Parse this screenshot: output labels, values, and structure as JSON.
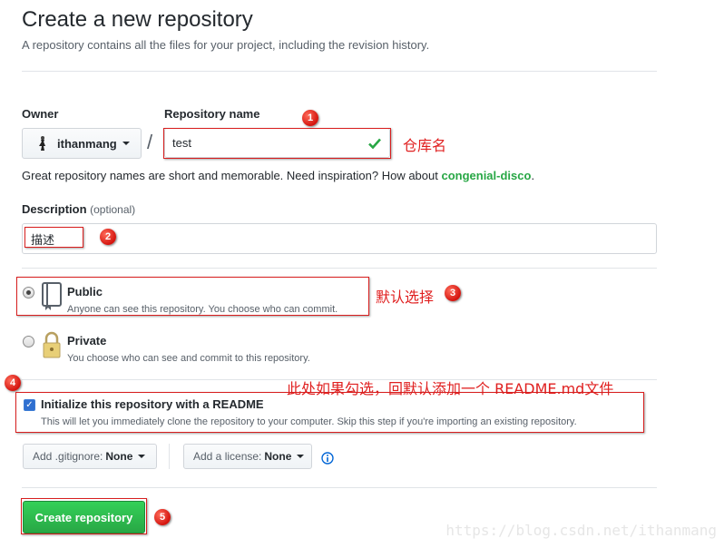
{
  "header": {
    "title": "Create a new repository",
    "subtitle": "A repository contains all the files for your project, including the revision history."
  },
  "owner": {
    "label": "Owner",
    "value": "ithanmang",
    "avatar_icon": "user-avatar"
  },
  "repo_name": {
    "label": "Repository name",
    "value": "test",
    "separator": "/",
    "valid_icon": "check-icon"
  },
  "name_hint": {
    "text": "Great repository names are short and memorable. Need inspiration? How about ",
    "suggestion": "congenial-disco",
    "suffix": "."
  },
  "description": {
    "label": "Description",
    "optional": "(optional)",
    "value": "描述"
  },
  "visibility": {
    "public": {
      "title": "Public",
      "note": "Anyone can see this repository. You choose who can commit.",
      "selected": true,
      "icon": "book-icon"
    },
    "private": {
      "title": "Private",
      "note": "You choose who can see and commit to this repository.",
      "selected": false,
      "icon": "lock-icon"
    }
  },
  "init_readme": {
    "label": "Initialize this repository with a README",
    "note": "This will let you immediately clone the repository to your computer. Skip this step if you're importing an existing repository.",
    "checked": true
  },
  "gitignore": {
    "label": "Add .gitignore:",
    "value": "None"
  },
  "license": {
    "label": "Add a license:",
    "value": "None",
    "info_icon": "info-icon"
  },
  "submit": {
    "label": "Create repository"
  },
  "annotations": {
    "badges": [
      "1",
      "2",
      "3",
      "4",
      "5"
    ],
    "note_repo": "仓库名",
    "note_default": "默认选择",
    "note_readme": "此处如果勾选，回默认添加一个 README.md文件"
  },
  "watermark": "https://blog.csdn.net/ithanmang",
  "colors": {
    "primary_green": "#28a745",
    "annotation_red": "#e02020",
    "link_green": "#28a745"
  }
}
